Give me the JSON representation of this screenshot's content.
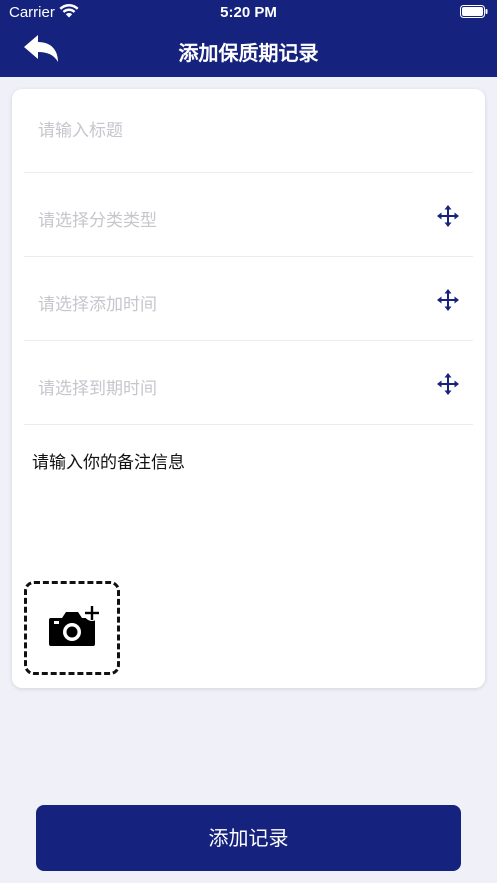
{
  "status_bar": {
    "carrier": "Carrier",
    "time": "5:20 PM"
  },
  "header": {
    "title": "添加保质期记录",
    "background": "#15237e"
  },
  "form": {
    "title_placeholder": "请输入标题",
    "category_placeholder": "请选择分类类型",
    "add_time_placeholder": "请选择添加时间",
    "expiry_placeholder": "请选择到期时间",
    "note_text": "请输入你的备注信息"
  },
  "icons": {
    "back": "back-arrow-icon",
    "select": "move-arrows-icon",
    "photo": "camera-add-icon"
  },
  "submit": {
    "label": "添加记录",
    "color": "#15237e"
  }
}
